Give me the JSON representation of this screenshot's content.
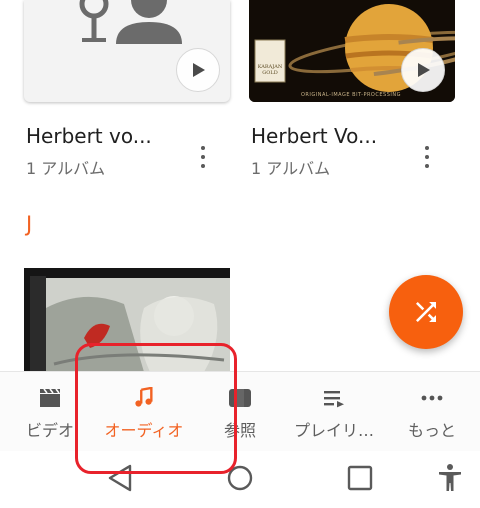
{
  "cards": [
    {
      "name": "Herbert vo...",
      "subtitle": "1 アルバム"
    },
    {
      "name": "Herbert Vo...",
      "subtitle": "1 アルバム"
    }
  ],
  "album_art_texts": {
    "logo": "KARAJAN GOLD",
    "caption": "ORIGINAL-IMAGE BIT-PROCESSING"
  },
  "section_letter": "J",
  "bottom_nav": [
    {
      "label": "ビデオ",
      "icon": "clapperboard-icon",
      "active": false
    },
    {
      "label": "オーディオ",
      "icon": "music-note-icon",
      "active": true
    },
    {
      "label": "参照",
      "icon": "folder-icon",
      "active": false
    },
    {
      "label": "プレイリ…",
      "icon": "playlist-icon",
      "active": false
    },
    {
      "label": "もっと",
      "icon": "more-horiz-icon",
      "active": false
    }
  ],
  "fab": {
    "icon": "shuffle-icon"
  },
  "colors": {
    "accent": "#f26222",
    "fab": "#f7600e",
    "highlight": "#e8222b"
  }
}
